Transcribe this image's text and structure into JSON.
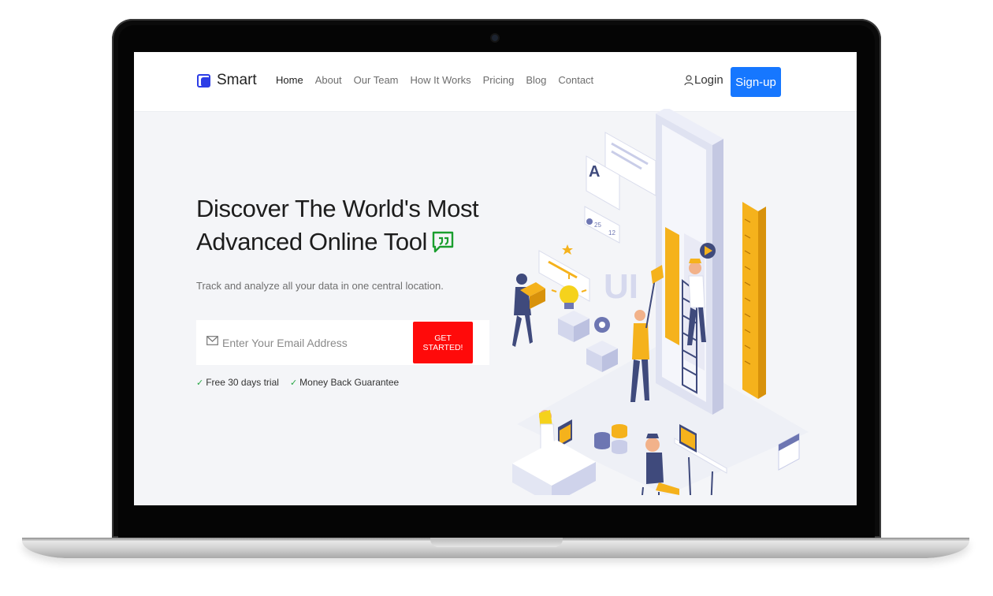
{
  "brand": {
    "name": "Smart",
    "accent": "#2c3de6"
  },
  "nav": {
    "items": [
      "Home",
      "About",
      "Our Team",
      "How It Works",
      "Pricing",
      "Blog",
      "Contact"
    ],
    "active_index": 0,
    "login_label": "Login",
    "signup_label": "Sign-up"
  },
  "hero": {
    "title_line1": "Discover The World's Most",
    "title_line2": "Advanced Online Tool",
    "subtitle": "Track and analyze all your data in one central location.",
    "email_placeholder": "Enter Your Email Address",
    "cta_label": "GET STARTED!",
    "features": [
      "Free 30 days trial",
      "Money Back Guarantee"
    ]
  },
  "illustration": {
    "text_a": "A",
    "text_ui": "UI",
    "text_25": "25",
    "text_12": "12"
  },
  "colors": {
    "signup": "#1677ff",
    "cta": "#ff0a0a",
    "check": "#28a745",
    "quote_icon": "#1a9e2e",
    "illustration_yellow": "#f5b21c",
    "illustration_lavender": "#c9cde8"
  },
  "icons": [
    "brand-logo-icon",
    "user-icon",
    "quote-icon",
    "mail-icon",
    "check-icon"
  ]
}
